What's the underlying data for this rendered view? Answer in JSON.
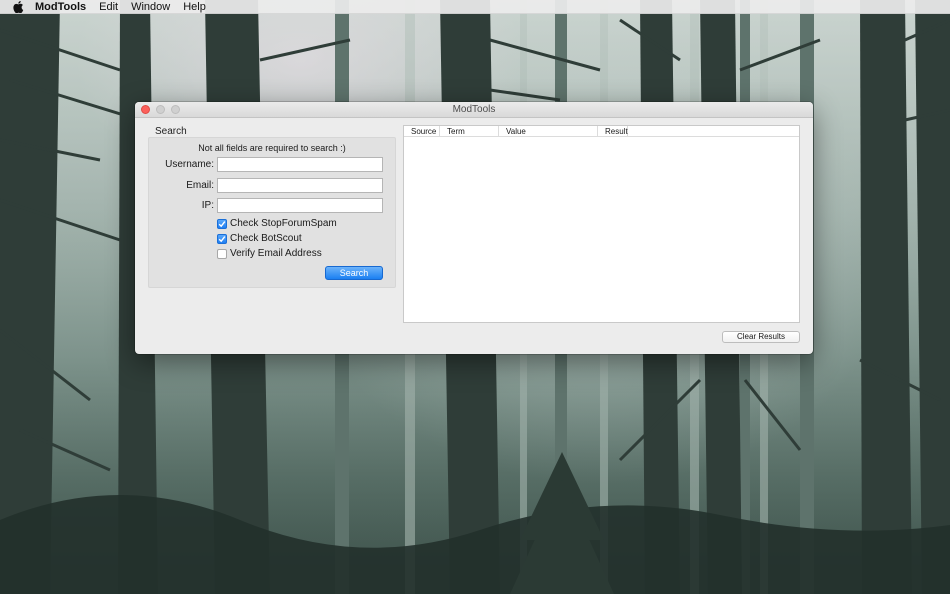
{
  "menubar": {
    "apple_icon": "apple-logo-icon",
    "app_name": "ModTools",
    "menus": [
      "Edit",
      "Window",
      "Help"
    ]
  },
  "window": {
    "title": "ModTools",
    "search_group": {
      "label": "Search",
      "hint": "Not all fields are required to search :)",
      "fields": {
        "username": {
          "label": "Username:",
          "value": ""
        },
        "email": {
          "label": "Email:",
          "value": ""
        },
        "ip": {
          "label": "IP:",
          "value": ""
        }
      },
      "checkboxes": {
        "stopforumspam": {
          "label": "Check StopForumSpam",
          "checked": true
        },
        "botscout": {
          "label": "Check BotScout",
          "checked": true
        },
        "verify_email": {
          "label": "Verify Email Address",
          "checked": false
        }
      },
      "search_button": "Search"
    },
    "results": {
      "columns": [
        "Source",
        "Term",
        "Value",
        "Result"
      ]
    },
    "clear_button": "Clear Results"
  },
  "colors": {
    "accent": "#1f7ff3",
    "close_button": "#fc605b"
  }
}
